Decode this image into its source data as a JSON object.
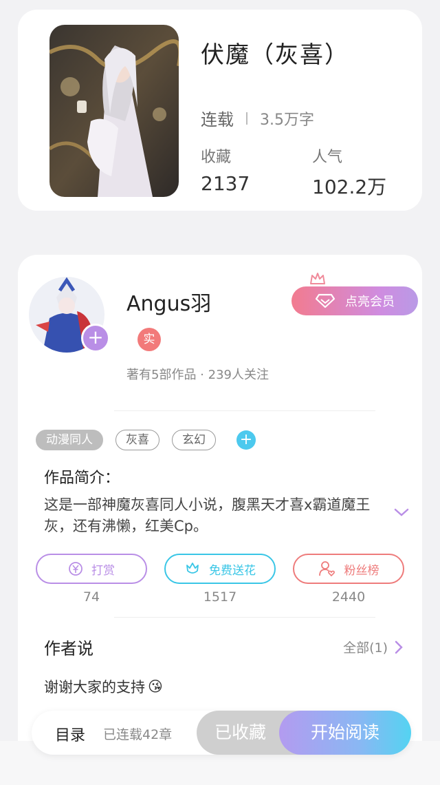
{
  "book": {
    "title": "伏魔（灰喜）",
    "status": "连载",
    "word_count": "3.5万字",
    "collect_label": "收藏",
    "collect_value": "2137",
    "popularity_label": "人气",
    "popularity_value": "102.2万"
  },
  "author": {
    "name": "Angus羽",
    "real_badge": "实",
    "meta": "著有5部作品 · 239人关注",
    "vip_button": "点亮会员"
  },
  "tags": {
    "items": [
      "动漫同人",
      "灰喜",
      "玄幻"
    ]
  },
  "intro": {
    "label": "作品简介：",
    "text": "这是一部神魔灰喜同人小说，腹黑天才喜x霸道魔王灰，还有沸懒，红美Cp。"
  },
  "actions": {
    "reward": {
      "label": "打赏",
      "count": "74",
      "color": "#b98ee6"
    },
    "flower": {
      "label": "免费送花",
      "count": "1517",
      "color": "#39c6e6"
    },
    "fans": {
      "label": "粉丝榜",
      "count": "2440",
      "color": "#ee7b7b"
    }
  },
  "author_says": {
    "title": "作者说",
    "all_link": "全部(1)",
    "message": "谢谢大家的支持",
    "emoji": "😘"
  },
  "bottom_bar": {
    "toc": "目录",
    "chapters": "已连载42章",
    "collected": "已收藏",
    "start_reading": "开始阅读"
  },
  "colors": {
    "accent_purple": "#b98ee6",
    "accent_cyan": "#4cc9ee",
    "accent_red": "#f27a7a"
  }
}
